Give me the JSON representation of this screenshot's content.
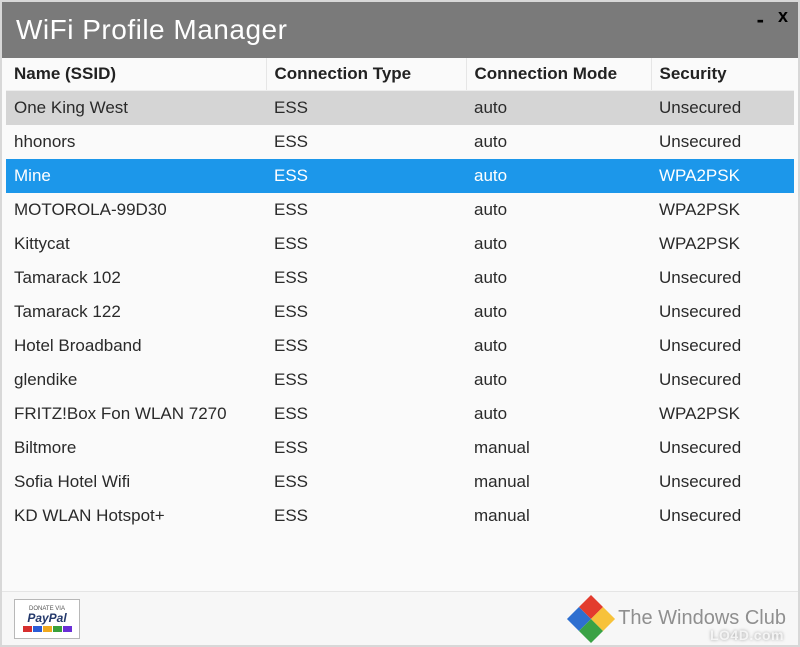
{
  "window": {
    "title": "WiFi Profile Manager",
    "minimize": "-",
    "close": "x"
  },
  "columns": {
    "name": "Name (SSID)",
    "type": "Connection Type",
    "mode": "Connection Mode",
    "security": "Security"
  },
  "rows": [
    {
      "name": "One King West",
      "type": "ESS",
      "mode": "auto",
      "security": "Unsecured",
      "state": "hover"
    },
    {
      "name": "hhonors",
      "type": "ESS",
      "mode": "auto",
      "security": "Unsecured",
      "state": ""
    },
    {
      "name": "Mine",
      "type": "ESS",
      "mode": "auto",
      "security": "WPA2PSK",
      "state": "selected"
    },
    {
      "name": "MOTOROLA-99D30",
      "type": "ESS",
      "mode": "auto",
      "security": "WPA2PSK",
      "state": ""
    },
    {
      "name": "Kittycat",
      "type": "ESS",
      "mode": "auto",
      "security": "WPA2PSK",
      "state": ""
    },
    {
      "name": "Tamarack 102",
      "type": "ESS",
      "mode": "auto",
      "security": "Unsecured",
      "state": ""
    },
    {
      "name": "Tamarack 122",
      "type": "ESS",
      "mode": "auto",
      "security": "Unsecured",
      "state": ""
    },
    {
      "name": "Hotel Broadband",
      "type": "ESS",
      "mode": "auto",
      "security": "Unsecured",
      "state": ""
    },
    {
      "name": "glendike",
      "type": "ESS",
      "mode": "auto",
      "security": "Unsecured",
      "state": ""
    },
    {
      "name": "FRITZ!Box Fon WLAN 7270",
      "type": "ESS",
      "mode": "auto",
      "security": "WPA2PSK",
      "state": ""
    },
    {
      "name": "Biltmore",
      "type": "ESS",
      "mode": "manual",
      "security": "Unsecured",
      "state": ""
    },
    {
      "name": "Sofia Hotel Wifi",
      "type": "ESS",
      "mode": "manual",
      "security": "Unsecured",
      "state": ""
    },
    {
      "name": "KD WLAN Hotspot+",
      "type": "ESS",
      "mode": "manual",
      "security": "Unsecured",
      "state": ""
    }
  ],
  "footer": {
    "paypal_top": "DONATE VIA",
    "paypal_main": "PayPal",
    "twc_label": "The Windows Club"
  },
  "watermark": "LO4D.com"
}
